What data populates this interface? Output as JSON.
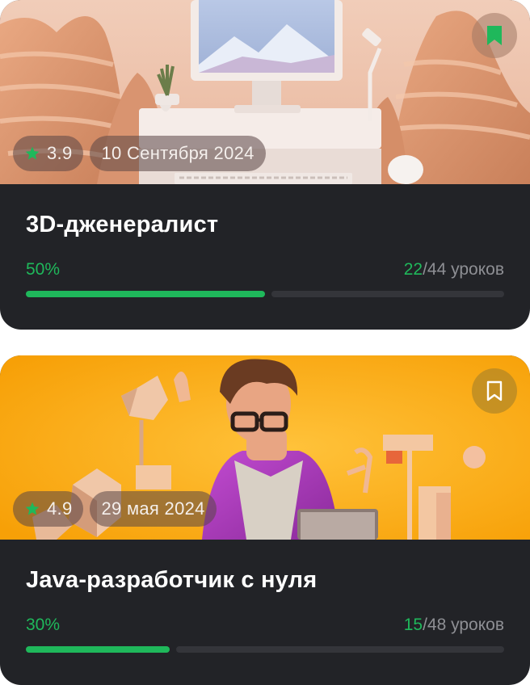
{
  "courses": [
    {
      "rating": "3.9",
      "date": "10 Сентября 2024",
      "title": "3D-дженералист",
      "progress_label": "50%",
      "progress": 0.5,
      "lessons_done": "22",
      "lessons_total": "/44 уроков",
      "bookmarked": true
    },
    {
      "rating": "4.9",
      "date": "29 мая 2024",
      "title": "Java-разработчик с нуля",
      "progress_label": "30%",
      "progress": 0.3,
      "lessons_done": "15",
      "lessons_total": "/48 уроков",
      "bookmarked": false
    }
  ],
  "colors": {
    "accent": "#1fb85b",
    "card": "#222327"
  },
  "icons": {
    "rating": "star-icon",
    "save": "bookmark-icon"
  }
}
